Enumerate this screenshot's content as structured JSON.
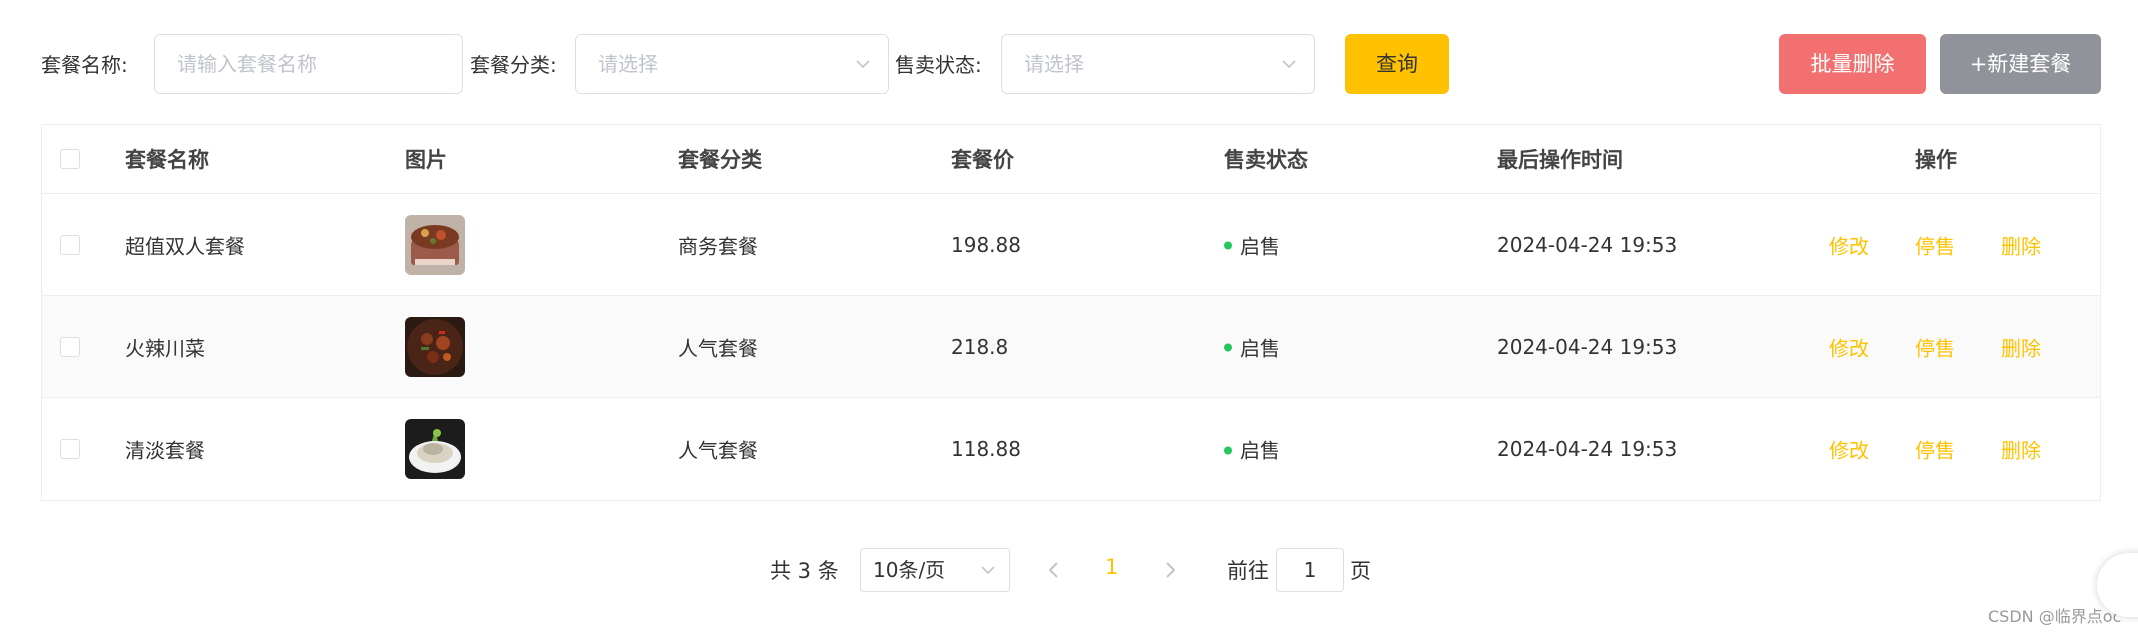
{
  "filters": {
    "name_label": "套餐名称:",
    "name_placeholder": "请输入套餐名称",
    "category_label": "套餐分类:",
    "category_placeholder": "请选择",
    "status_label": "售卖状态:",
    "status_placeholder": "请选择",
    "query_button": "查询"
  },
  "actions": {
    "batch_delete": "批量删除",
    "new_combo": "+新建套餐"
  },
  "table": {
    "headers": {
      "name": "套餐名称",
      "image": "图片",
      "category": "套餐分类",
      "price": "套餐价",
      "status": "售卖状态",
      "updated": "最后操作时间",
      "operations": "操作"
    },
    "rows": [
      {
        "name": "超值双人套餐",
        "image_icon": "combo-dish-image",
        "category": "商务套餐",
        "price": "198.88",
        "status": "启售",
        "updated": "2024-04-24 19:53"
      },
      {
        "name": "火辣川菜",
        "image_icon": "spicy-dish-image",
        "category": "人气套餐",
        "price": "218.8",
        "status": "启售",
        "updated": "2024-04-24 19:53"
      },
      {
        "name": "清淡套餐",
        "image_icon": "light-dish-image",
        "category": "人气套餐",
        "price": "118.88",
        "status": "启售",
        "updated": "2024-04-24 19:53"
      }
    ],
    "op_labels": {
      "edit": "修改",
      "stop": "停售",
      "delete": "删除"
    }
  },
  "pagination": {
    "total_text": "共 3 条",
    "page_size": "10条/页",
    "current_page": "1",
    "goto_prefix": "前往",
    "goto_value": "1",
    "goto_suffix": "页"
  },
  "watermark": "CSDN @临界点oc",
  "colors": {
    "accent": "#ffc200",
    "danger": "#f37070",
    "neutral_button": "#909399",
    "status_dot": "#22c55e"
  }
}
